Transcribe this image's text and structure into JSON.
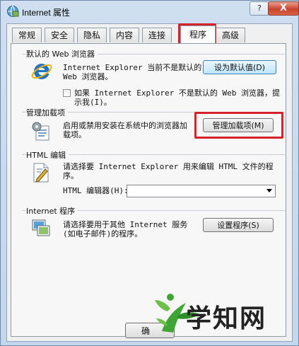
{
  "window": {
    "title": "Internet 属性",
    "help_label": "?",
    "close_label": "X"
  },
  "tabs": [
    {
      "label": "常规"
    },
    {
      "label": "安全"
    },
    {
      "label": "隐私"
    },
    {
      "label": "内容"
    },
    {
      "label": "连接"
    },
    {
      "label": "程序"
    },
    {
      "label": "高级"
    }
  ],
  "active_tab": "程序",
  "sections": {
    "default_browser": {
      "title": "默认的 Web 浏览器",
      "text_line1": "Internet Explorer 当前不是默认的",
      "text_line2": "Web 浏览器。",
      "button": "设为默认值(D)",
      "checkbox_line1": "如果 Internet Explorer 不是默认的 Web 浏览器，提",
      "checkbox_line2": "示我(I)。",
      "checkbox_checked": false
    },
    "addons": {
      "title": "管理加载项",
      "text_line1": "启用或禁用安装在系统中的浏览器加",
      "text_line2": "载项。",
      "button": "管理加载项(M)"
    },
    "html_editing": {
      "title": "HTML 编辑",
      "text_line1": "请选择要 Internet Explorer 用来编辑 HTML 文件的程",
      "text_line2": "序。",
      "editor_label": "HTML 编辑器(H):",
      "editor_value": ""
    },
    "internet_programs": {
      "title": "Internet 程序",
      "text_line1": "请选择要用于其他 Internet 服务",
      "text_line2": "(如电子邮件)的程序。",
      "button": "设置程序(S)"
    }
  },
  "bottom_button_label": "确",
  "watermark": {
    "text": "学知网"
  },
  "colors": {
    "highlight": "#d4232b",
    "ie_blue": "#1e73c8",
    "watermark_green": "#3fa535"
  }
}
